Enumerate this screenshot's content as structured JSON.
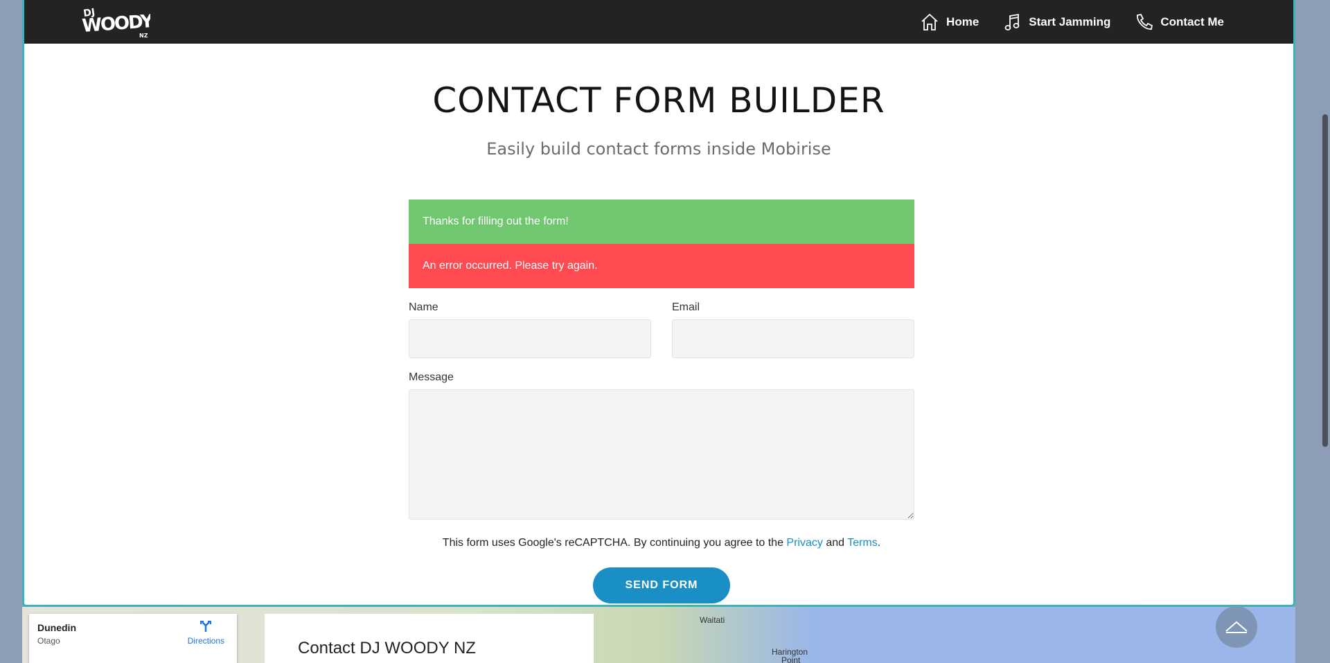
{
  "navbar": {
    "logo_text": "DJ WOODY NZ",
    "items": [
      {
        "label": "Home",
        "icon": "home-icon"
      },
      {
        "label": "Start Jamming",
        "icon": "music-note-icon"
      },
      {
        "label": "Contact Me",
        "icon": "phone-icon"
      }
    ]
  },
  "header": {
    "title": "CONTACT FORM BUILDER",
    "subtitle": "Easily build contact forms inside Mobirise"
  },
  "form": {
    "success_message": "Thanks for filling out the form!",
    "error_message": "An error occurred. Please try again.",
    "name_label": "Name",
    "name_value": "",
    "email_label": "Email",
    "email_value": "",
    "message_label": "Message",
    "message_value": "",
    "notice_text": "This form uses Google's reCAPTCHA. By continuing you agree to the",
    "privacy_link": "Privacy",
    "and_text": "and",
    "terms_link": "Terms",
    "period": ".",
    "send_label": "SEND FORM"
  },
  "map": {
    "city": "Dunedin",
    "region": "Otago",
    "directions_label": "Directions",
    "contact_title": "Contact DJ WOODY NZ",
    "label_waitati": "Waitati",
    "label_harington": "Harington",
    "label_point": "Point"
  },
  "colors": {
    "navbar": "#232323",
    "accent": "#1a8fc6",
    "success": "#70c770",
    "error": "#ff4a52",
    "frame_border": "#3bb3bd"
  }
}
